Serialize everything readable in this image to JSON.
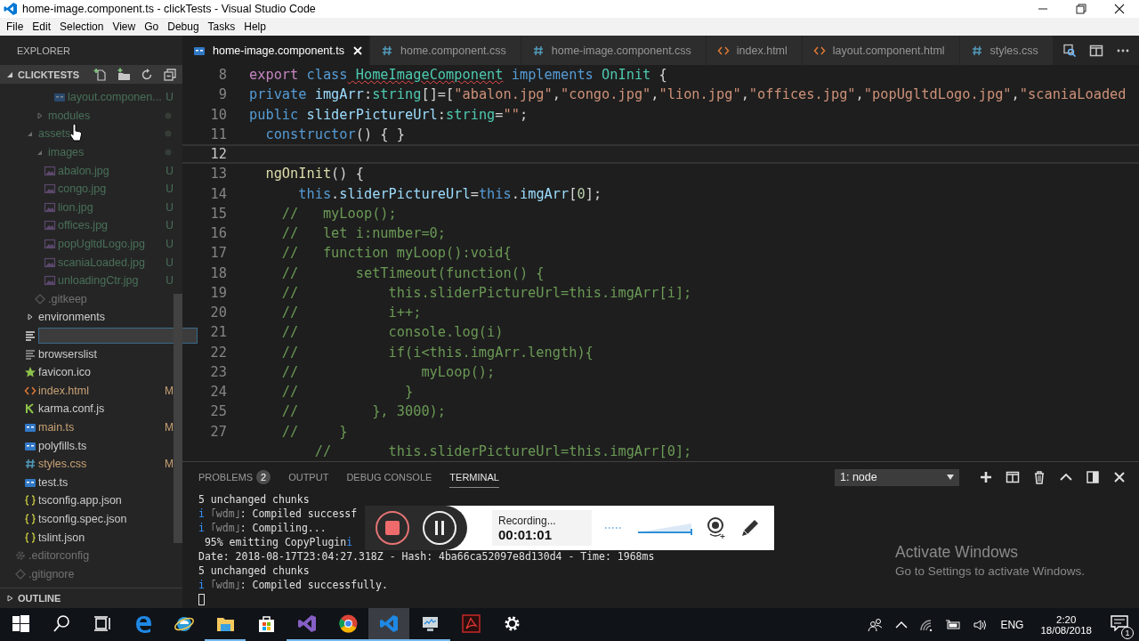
{
  "window": {
    "title": "home-image.component.ts - clickTests - Visual Studio Code"
  },
  "menu": [
    "File",
    "Edit",
    "Selection",
    "View",
    "Go",
    "Debug",
    "Tasks",
    "Help"
  ],
  "sidebar": {
    "title": "EXPLORER",
    "section": {
      "title": "CLICKTESTS",
      "expanded": true
    },
    "tree": [
      {
        "kind": "group",
        "children": [
          {
            "kind": "group",
            "children": [
              {
                "kind": "group",
                "children": [
                  {
                    "kind": "group",
                    "children": [
                      {
                        "label": "layout.componen...",
                        "kind": "ts",
                        "badge": "U",
                        "dimmed": true
                      }
                    ]
                  }
                ]
              },
              {
                "label": "modules",
                "kind": "folder",
                "expanded": false,
                "dot": true,
                "dimmed": true
              }
            ]
          },
          {
            "label": "assets",
            "kind": "folder",
            "expanded": true,
            "dot": true,
            "dimmed": true,
            "children": [
              {
                "label": "images",
                "kind": "folder",
                "expanded": true,
                "dot": true,
                "dimmed": true,
                "children": [
                  {
                    "label": "abalon.jpg",
                    "kind": "image",
                    "badge": "U",
                    "dimmed": true
                  },
                  {
                    "label": "congo.jpg",
                    "kind": "image",
                    "badge": "U",
                    "dimmed": true
                  },
                  {
                    "label": "lion.jpg",
                    "kind": "image",
                    "badge": "U",
                    "dimmed": true
                  },
                  {
                    "label": "offices.jpg",
                    "kind": "image",
                    "badge": "U",
                    "dimmed": true
                  },
                  {
                    "label": "popUgltdLogo.jpg",
                    "kind": "image",
                    "badge": "U",
                    "dimmed": true
                  },
                  {
                    "label": "scaniaLoaded.jpg",
                    "kind": "image",
                    "badge": "U",
                    "dimmed": true
                  },
                  {
                    "label": "unloadingCtr.jpg",
                    "kind": "image",
                    "badge": "U",
                    "dimmed": true
                  }
                ]
              },
              {
                "label": ".gitkeep",
                "kind": "git",
                "dimmed": true
              }
            ]
          },
          {
            "label": "environments",
            "kind": "folder",
            "expanded": false,
            "dimmed": false
          },
          {
            "kind": "rename"
          },
          {
            "label": "browserslist",
            "kind": "text",
            "dimmed": false
          },
          {
            "label": "favicon.ico",
            "kind": "favicon",
            "dimmed": false
          },
          {
            "label": "index.html",
            "kind": "html",
            "badge": "M",
            "dimmed": false
          },
          {
            "label": "karma.conf.js",
            "kind": "karma",
            "dimmed": false
          },
          {
            "label": "main.ts",
            "kind": "ts",
            "badge": "M",
            "dimmed": false
          },
          {
            "label": "polyfills.ts",
            "kind": "ts",
            "dimmed": false
          },
          {
            "label": "styles.css",
            "kind": "css",
            "badge": "M",
            "dimmed": false
          },
          {
            "label": "test.ts",
            "kind": "ts",
            "dimmed": false
          },
          {
            "label": "tsconfig.app.json",
            "kind": "json",
            "dimmed": false
          },
          {
            "label": "tsconfig.spec.json",
            "kind": "json",
            "dimmed": false
          },
          {
            "label": "tslint.json",
            "kind": "json",
            "dimmed": false
          }
        ]
      },
      {
        "label": ".editorconfig",
        "kind": "config",
        "dimmed": true
      },
      {
        "label": ".gitignore",
        "kind": "git",
        "dimmed": true
      }
    ],
    "outline": {
      "title": "OUTLINE",
      "expanded": false
    }
  },
  "editor": {
    "tabs": [
      {
        "label": "home-image.component.ts",
        "kind": "ts",
        "selected": true
      },
      {
        "label": "home.component.css",
        "kind": "css",
        "selected": false
      },
      {
        "label": "home-image.component.css",
        "kind": "css",
        "selected": false
      },
      {
        "label": "index.html",
        "kind": "html",
        "selected": false
      },
      {
        "label": "layout.component.html",
        "kind": "html",
        "selected": false
      },
      {
        "label": "styles.css",
        "kind": "css",
        "selected": false
      }
    ],
    "lines": [
      {
        "number": "8",
        "current": false,
        "tokens": [
          {
            "text": "export",
            "kind": "kw2"
          },
          {
            "text": " class",
            "kind": "kw"
          },
          {
            "text": " HomeImageComponent",
            "kind": "type-err"
          },
          {
            "text": " implements",
            "kind": "kw"
          },
          {
            "text": " OnInit",
            "kind": "type"
          },
          {
            "text": " {",
            "kind": "plain"
          }
        ]
      },
      {
        "number": "9",
        "current": false,
        "tokens": [
          {
            "text": "private",
            "kind": "kw"
          },
          {
            "text": " imgArr",
            "kind": "var"
          },
          {
            "text": ":",
            "kind": "plain"
          },
          {
            "text": "string",
            "kind": "type"
          },
          {
            "text": "[]=[",
            "kind": "plain"
          },
          {
            "text": "\"abalon.jpg\"",
            "kind": "str"
          },
          {
            "text": ",",
            "kind": "plain"
          },
          {
            "text": "\"congo.jpg\"",
            "kind": "str"
          },
          {
            "text": ",",
            "kind": "plain"
          },
          {
            "text": "\"lion.jpg\"",
            "kind": "str"
          },
          {
            "text": ",",
            "kind": "plain"
          },
          {
            "text": "\"offices.jpg\"",
            "kind": "str"
          },
          {
            "text": ",",
            "kind": "plain"
          },
          {
            "text": "\"popUgltdLogo.jpg\"",
            "kind": "str"
          },
          {
            "text": ",",
            "kind": "plain"
          },
          {
            "text": "\"scaniaLoaded",
            "kind": "str"
          }
        ]
      },
      {
        "number": "10",
        "current": false,
        "tokens": [
          {
            "text": "public",
            "kind": "kw"
          },
          {
            "text": " sliderPictureUrl",
            "kind": "var"
          },
          {
            "text": ":",
            "kind": "plain"
          },
          {
            "text": "string",
            "kind": "type"
          },
          {
            "text": "=",
            "kind": "plain"
          },
          {
            "text": "\"\"",
            "kind": "str"
          },
          {
            "text": ";",
            "kind": "plain"
          }
        ]
      },
      {
        "number": "11",
        "current": false,
        "tokens": [
          {
            "text": "  constructor",
            "kind": "kw"
          },
          {
            "text": "() { }",
            "kind": "plain"
          }
        ]
      },
      {
        "number": "12",
        "current": true
      },
      {
        "number": "13",
        "current": false,
        "tokens": [
          {
            "text": "  ngOnInit",
            "kind": "fn"
          },
          {
            "text": "() {",
            "kind": "plain"
          }
        ]
      },
      {
        "number": "14",
        "current": false,
        "tokens": [
          {
            "text": "      this",
            "kind": "kw"
          },
          {
            "text": ".",
            "kind": "plain"
          },
          {
            "text": "sliderPictureUrl",
            "kind": "var"
          },
          {
            "text": "=",
            "kind": "plain"
          },
          {
            "text": "this",
            "kind": "kw"
          },
          {
            "text": ".",
            "kind": "plain"
          },
          {
            "text": "imgArr",
            "kind": "var"
          },
          {
            "text": "[",
            "kind": "plain"
          },
          {
            "text": "0",
            "kind": "num"
          },
          {
            "text": "];",
            "kind": "plain"
          }
        ]
      },
      {
        "number": "15",
        "current": false,
        "tokens": [
          {
            "text": "    //   myLoop();",
            "kind": "cmt"
          }
        ]
      },
      {
        "number": "16",
        "current": false,
        "tokens": [
          {
            "text": "    //   let i:number=0;",
            "kind": "cmt"
          }
        ]
      },
      {
        "number": "17",
        "current": false,
        "tokens": [
          {
            "text": "    //   function myLoop():void{",
            "kind": "cmt"
          }
        ]
      },
      {
        "number": "18",
        "current": false,
        "tokens": [
          {
            "text": "    //       setTimeout(function() {",
            "kind": "cmt"
          }
        ]
      },
      {
        "number": "19",
        "current": false,
        "tokens": [
          {
            "text": "    //           this.sliderPictureUrl=this.imgArr[i];",
            "kind": "cmt"
          }
        ]
      },
      {
        "number": "20",
        "current": false,
        "tokens": [
          {
            "text": "    //           i++;",
            "kind": "cmt"
          }
        ]
      },
      {
        "number": "21",
        "current": false,
        "tokens": [
          {
            "text": "    //           console.log(i)",
            "kind": "cmt"
          }
        ]
      },
      {
        "number": "22",
        "current": false,
        "tokens": [
          {
            "text": "    //           if(i<this.imgArr.length){",
            "kind": "cmt"
          }
        ]
      },
      {
        "number": "23",
        "current": false,
        "tokens": [
          {
            "text": "    //               myLoop();",
            "kind": "cmt"
          }
        ]
      },
      {
        "number": "24",
        "current": false,
        "tokens": [
          {
            "text": "    //             }",
            "kind": "cmt"
          }
        ]
      },
      {
        "number": "25",
        "current": false,
        "tokens": [
          {
            "text": "    //         }, 3000);",
            "kind": "cmt"
          }
        ]
      },
      {
        "number": "27",
        "current": false,
        "tokens": [
          {
            "text": "    //     }",
            "kind": "cmt"
          }
        ]
      },
      {
        "current": false,
        "tokens": [
          {
            "text": "        //       this.sliderPictureUrl=this.imgArr[0];",
            "kind": "cmt"
          }
        ]
      }
    ]
  },
  "panel": {
    "tabs": [
      {
        "label": "PROBLEMS",
        "badge": "2",
        "selected": false
      },
      {
        "label": "OUTPUT",
        "selected": false
      },
      {
        "label": "DEBUG CONSOLE",
        "selected": false
      },
      {
        "label": "TERMINAL",
        "selected": true
      }
    ],
    "terminal_select": "1: node",
    "lines": [
      [
        {
          "text": "5 unchanged chunks",
          "kind": "text"
        }
      ],
      [
        {
          "text": "i",
          "kind": "info"
        },
        {
          "text": " ｢wdm｣",
          "kind": "dim"
        },
        {
          "text": ": Compiled successf",
          "kind": "text"
        }
      ],
      [
        {
          "text": "i",
          "kind": "info"
        },
        {
          "text": " ｢wdm｣",
          "kind": "dim"
        },
        {
          "text": ": Compiling...",
          "kind": "text"
        }
      ],
      [
        {
          "text": " 95% emitting CopyPlugin",
          "kind": "text"
        },
        {
          "text": "i",
          "kind": "info"
        }
      ],
      [
        {
          "text": "Date: 2018-08-17T23:04:27.318Z - Hash: 4ba66ca52097e8d130d4 - Time: 1968ms",
          "kind": "text"
        }
      ],
      [
        {
          "text": "5 unchanged chunks",
          "kind": "text"
        }
      ],
      [
        {
          "text": "i",
          "kind": "info"
        },
        {
          "text": " ｢wdm｣",
          "kind": "dim"
        },
        {
          "text": ": Compiled successfully.",
          "kind": "text"
        }
      ],
      [
        {
          "kind": "cursor"
        }
      ]
    ]
  },
  "recorder": {
    "status": "Recording...",
    "time": "00:01:01"
  },
  "activation_notice": {
    "title": "Activate Windows",
    "message": "Go to Settings to activate Windows."
  },
  "taskbar": {
    "apps": [
      {
        "kind": "start",
        "selected": false,
        "running": false
      },
      {
        "kind": "search",
        "selected": false,
        "running": false
      },
      {
        "kind": "taskview",
        "selected": false,
        "running": false
      },
      {
        "kind": "edge",
        "selected": false,
        "running": false
      },
      {
        "kind": "ie",
        "selected": false,
        "running": false
      },
      {
        "kind": "explorer",
        "selected": false,
        "running": true
      },
      {
        "kind": "store",
        "selected": false,
        "running": false
      },
      {
        "kind": "vs",
        "selected": false,
        "running": true
      },
      {
        "kind": "chrome",
        "selected": false,
        "running": true
      },
      {
        "kind": "vscode",
        "selected": true,
        "running": true
      },
      {
        "kind": "monitor",
        "selected": false,
        "running": true
      },
      {
        "kind": "acrobat",
        "selected": false,
        "running": false
      },
      {
        "kind": "settings",
        "selected": false,
        "running": false
      }
    ],
    "language": "ENG",
    "time": "2:20",
    "date": "18/08/2018",
    "notifications": "1"
  }
}
